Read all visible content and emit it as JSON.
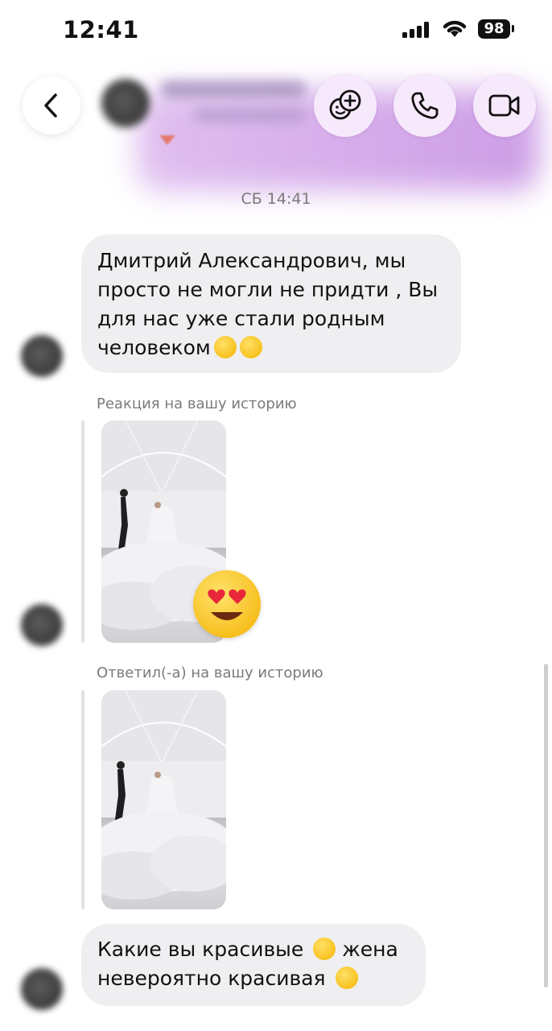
{
  "status_bar": {
    "time": "12:41",
    "battery": "98"
  },
  "header": {
    "back_icon": "chevron-left-icon",
    "buttons": [
      "add-effect-icon",
      "phone-icon",
      "video-camera-icon"
    ]
  },
  "chat": {
    "timestamp": "СБ 14:41",
    "message1": "Дмитрий Александрович, мы\nпросто не могли не придти , Вы\nдля нас уже стали родным\nчеловеком",
    "caption_reaction": "Реакция на вашу историю",
    "caption_reply": "Ответил(-а) на вашу историю",
    "message2_line1": "Какие вы красивые",
    "message2_line1b": "жена",
    "message2_line2": "невероятно красивая"
  },
  "colors": {
    "bubble": "#efeff1",
    "header_button": "#f6e9fb",
    "header_tint": "#c48ce1"
  }
}
